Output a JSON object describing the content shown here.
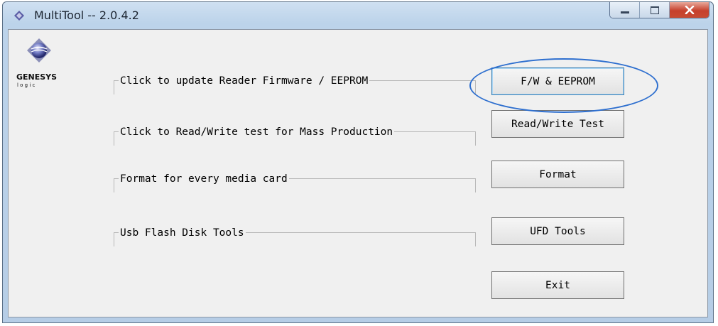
{
  "window": {
    "title": "MultiTool -- 2.0.4.2",
    "controls": {
      "close_glyph": "x"
    }
  },
  "logo": {
    "brand_top": "GENESYS",
    "brand_bottom": "l o g i c"
  },
  "groups": [
    {
      "label": "Click to update Reader Firmware / EEPROM"
    },
    {
      "label": "Click to Read/Write test for Mass Production"
    },
    {
      "label": "Format for every media card"
    },
    {
      "label": "Usb Flash Disk Tools"
    }
  ],
  "buttons": {
    "fw_eeprom": "F/W & EEPROM",
    "read_write_test": "Read/Write Test",
    "format": "Format",
    "ufd_tools": "UFD Tools",
    "exit": "Exit"
  },
  "colors": {
    "highlight": "#2e6fcf",
    "close_button": "#c6402c"
  }
}
